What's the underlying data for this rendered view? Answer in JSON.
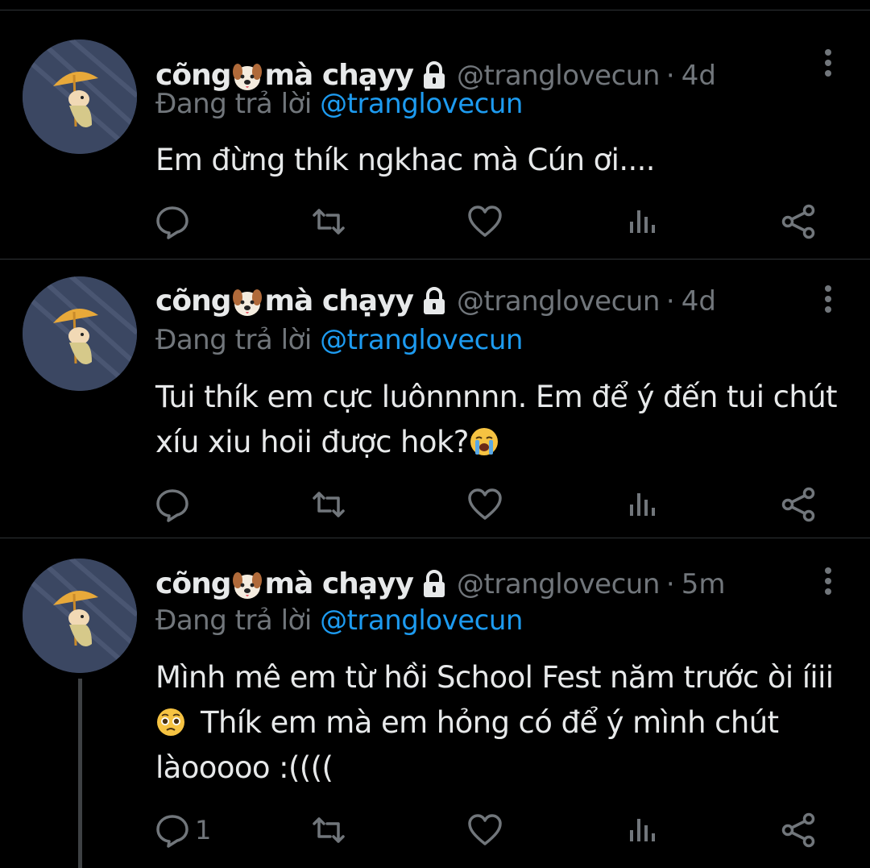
{
  "tweets": [
    {
      "name_part1": "cõng",
      "name_part2": "mà chạyy",
      "handle": "@tranglovecun",
      "dot": "·",
      "time": "4d",
      "reply_prefix": "Đang trả lời",
      "reply_to": "@tranglovecun",
      "text": "Em đừng thík ngkhac mà Cún ơi....",
      "reply_count": ""
    },
    {
      "name_part1": "cõng",
      "name_part2": "mà chạyy",
      "handle": "@tranglovecun",
      "dot": "·",
      "time": "4d",
      "reply_prefix": "Đang trả lời",
      "reply_to": "@tranglovecun",
      "text_line1": "Tui thík em cực luônnnnn. Em để ý đến tui chút",
      "text_line2": "xíu xiu hoii được hok?",
      "reply_count": ""
    },
    {
      "name_part1": "cõng",
      "name_part2": "mà chạyy",
      "handle": "@tranglovecun",
      "dot": "·",
      "time": "5m",
      "reply_prefix": "Đang trả lời",
      "reply_to": "@tranglovecun",
      "text_line1": "Mình mê em từ hồi School Fest năm trước òi íiii",
      "text_line2": "Thík em mà em hỏng có để ý mình chút",
      "text_line3": "làooooo :((((",
      "reply_count": "1"
    }
  ],
  "icons": {
    "name_emoji": "dog-face",
    "lock": "lock",
    "more": "vertical-ellipsis",
    "reply": "speech-bubble",
    "retweet": "retweet-arrows",
    "like": "heart-outline",
    "views": "bar-chart",
    "share": "share-nodes",
    "emoji_crying": "loudly-crying-face",
    "emoji_pleading": "pleading-face"
  },
  "colors": {
    "background": "#000000",
    "text": "#e7e9ea",
    "muted": "#71767b",
    "mention": "#1d9bf0",
    "divider": "#2f3336"
  }
}
